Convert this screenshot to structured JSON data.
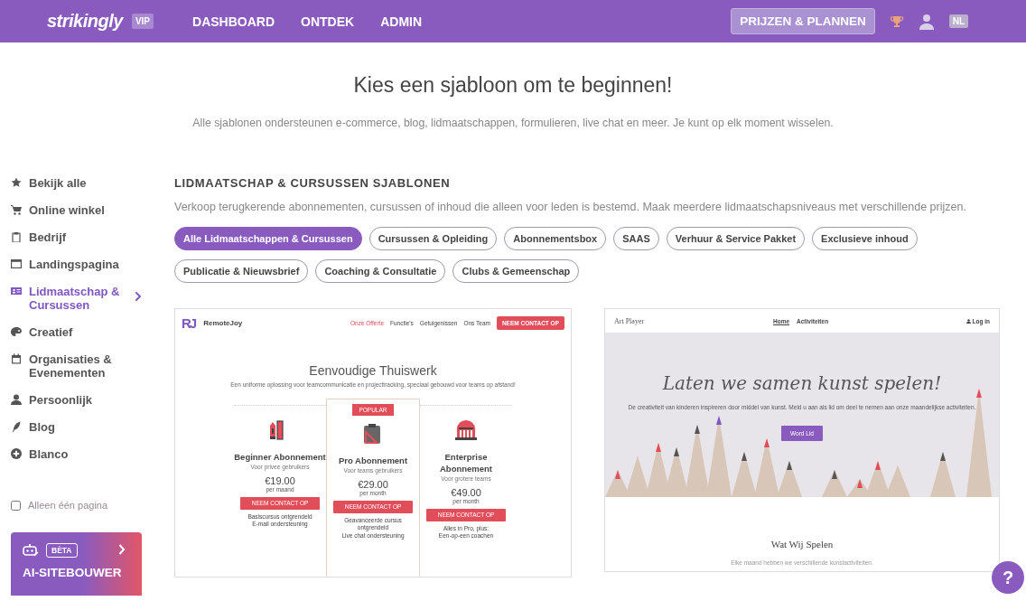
{
  "header": {
    "logo": "strikingly",
    "badge": "VIP",
    "nav": [
      {
        "label": "DASHBOARD"
      },
      {
        "label": "ONTDEK"
      },
      {
        "label": "ADMIN"
      }
    ],
    "pricing_button": "PRIJZEN & PLANNEN",
    "language": "NL"
  },
  "intro": {
    "title": "Kies een sjabloon om te beginnen!",
    "subtitle": "Alle sjablonen ondersteunen e-commerce, blog, lidmaatschappen, formulieren, live chat en meer. Je kunt op elk moment wisselen."
  },
  "sidebar": {
    "items": [
      {
        "label": "Bekijk alle",
        "selected": false
      },
      {
        "label": "Online winkel",
        "selected": false
      },
      {
        "label": "Bedrijf",
        "selected": false
      },
      {
        "label": "Landingspagina",
        "selected": false
      },
      {
        "label": "Lidmaatschap & Cursussen",
        "selected": true
      },
      {
        "label": "Creatief",
        "selected": false
      },
      {
        "label": "Organisaties & Evenementen",
        "selected": false
      },
      {
        "label": "Persoonlijk",
        "selected": false
      },
      {
        "label": "Blog",
        "selected": false
      },
      {
        "label": "Blanco",
        "selected": false
      }
    ],
    "single_page": {
      "label": "Alleen één pagina",
      "checked": false
    },
    "ai_builder": {
      "badge": "BÈTA",
      "label": "AI-SITEBOUWER"
    }
  },
  "section": {
    "title": "LIDMAATSCHAP & CURSUSSEN SJABLONEN",
    "description": "Verkoop terugkerende abonnementen, cursussen of inhoud die alleen voor leden is bestemd. Maak meerdere lidmaatschapsniveaus met verschillende prijzen.",
    "filters": [
      {
        "label": "Alle Lidmaatschappen & Cursussen",
        "selected": true
      },
      {
        "label": "Cursussen & Opleiding",
        "selected": false
      },
      {
        "label": "Abonnementsbox",
        "selected": false
      },
      {
        "label": "SAAS",
        "selected": false
      },
      {
        "label": "Verhuur & Service Pakket",
        "selected": false
      },
      {
        "label": "Exclusieve inhoud",
        "selected": false
      },
      {
        "label": "Publicatie & Nieuwsbrief",
        "selected": false
      },
      {
        "label": "Coaching & Consultatie",
        "selected": false
      },
      {
        "label": "Clubs & Gemeenschap",
        "selected": false
      }
    ]
  },
  "templates": [
    {
      "kind": "pricing",
      "logo_mark": "RJ",
      "logo": "RemoteJoy",
      "nav": [
        {
          "label": "Onze Offerte",
          "selected": true
        },
        {
          "label": "Functie's",
          "selected": false
        },
        {
          "label": "Getuigenissen",
          "selected": false
        },
        {
          "label": "Ons Team",
          "selected": false
        }
      ],
      "cta": "NEEM CONTACT OP",
      "title": "Eenvoudige Thuiswerk",
      "subtitle": "Een uniforme oplossing voor teamcommunicatie en projecttracking, speciaal gebouwd voor teams op afstand!",
      "plans": [
        {
          "name": "Beginner Abonnement",
          "audience": "Voor privee gebruikers",
          "price": "€19.00",
          "period": "per maand",
          "button": "NEEM CONTACT OP",
          "features": [
            "Basiscursus ontgrendeld",
            "E-mail ondersteuning"
          ],
          "featured": false
        },
        {
          "badge": "POPULAR",
          "name": "Pro Abonnement",
          "audience": "Voor teams gebruikers",
          "price": "€29.00",
          "period": "per month",
          "button": "NEEM CONTACT OP",
          "features": [
            "Geavanceerde cursus ontgrendeld",
            "Live chat ondersteuning"
          ],
          "featured": true
        },
        {
          "name": "Enterprise Abonnement",
          "audience": "Voor grotere teams",
          "price": "€49.00",
          "period": "per month",
          "button": "NEEM CONTACT OP",
          "features": [
            "Alles in Pro, plus:",
            "Een-op-een coachen"
          ],
          "featured": false
        }
      ]
    },
    {
      "kind": "hero",
      "logo": "Art Player",
      "nav": [
        {
          "label": "Home",
          "selected": true
        },
        {
          "label": "Activiteiten",
          "selected": false
        }
      ],
      "login": "Log in",
      "title": "Laten we samen kunst spelen!",
      "text": "De creativiteit van kinderen inspireren door middel van kunst. Meld u aan als lid om deel te nemen aan onze maandelijkse activiteiten.",
      "button": "Word Lid",
      "section_title": "Wat Wij Spelen",
      "section_text": "Elke maand hebben we verschillende kunstactiviteiten."
    }
  ],
  "help_button": "?"
}
